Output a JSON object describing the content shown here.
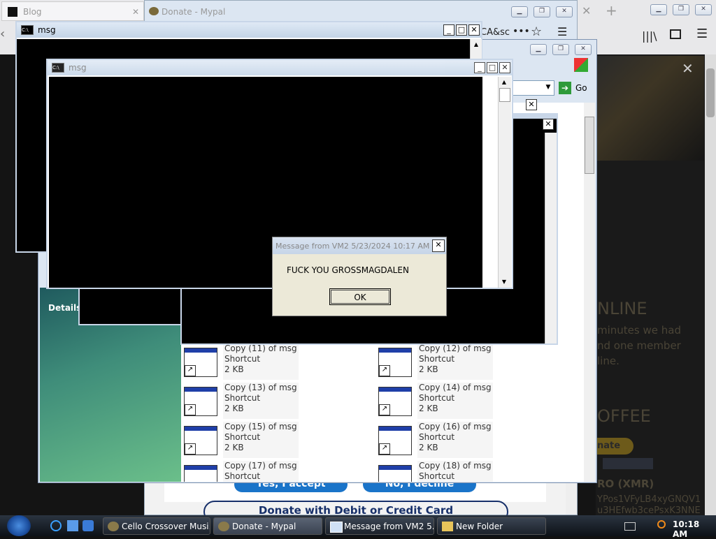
{
  "browser": {
    "tab_blog": "Blog",
    "tab_donate": "Donate - Mypal",
    "address_fragment": "CA&sc",
    "menu_dots": "•••"
  },
  "right_page": {
    "heading_online": "NLINE",
    "text_line1": "minutes we had",
    "text_line2": "nd one member",
    "text_line3": "line.",
    "heading_coffee": "OFFEE",
    "donate_btn": "nate",
    "xmr_label": "RO (XMR)",
    "xmr_addr1": "YPos1VFyLB4xyGNQV1",
    "xmr_addr2": "u3HEfwb3cePsxK3NNE"
  },
  "donate_page": {
    "yes_btn": "Yes, I accept",
    "no_btn": "No, I decline",
    "debit_btn": "Donate with Debit or Credit Card"
  },
  "cmd_window_back": {
    "title": "msg"
  },
  "cmd_window_front": {
    "title": "msg"
  },
  "explorer": {
    "go_label": "Go",
    "details_label": "Details",
    "files": [
      {
        "name": "Copy (11) of msg",
        "type": "Shortcut",
        "size": "2 KB"
      },
      {
        "name": "Copy (12) of msg",
        "type": "Shortcut",
        "size": "2 KB"
      },
      {
        "name": "Copy (13) of msg",
        "type": "Shortcut",
        "size": "2 KB"
      },
      {
        "name": "Copy (14) of msg",
        "type": "Shortcut",
        "size": "2 KB"
      },
      {
        "name": "Copy (15) of msg",
        "type": "Shortcut",
        "size": "2 KB"
      },
      {
        "name": "Copy (16) of msg",
        "type": "Shortcut",
        "size": "2 KB"
      },
      {
        "name": "Copy (17) of msg",
        "type": "Shortcut",
        "size": ""
      },
      {
        "name": "Copy (18) of msg",
        "type": "Shortcut",
        "size": ""
      }
    ]
  },
  "dialog": {
    "title": "Message from VM2 5/23/2024 10:17 AM",
    "message": "FUCK YOU GROSSMAGDALEN",
    "ok": "OK"
  },
  "taskbar": {
    "items": [
      {
        "label": "Cello Crossover Musi..."
      },
      {
        "label": "Donate - Mypal"
      },
      {
        "label": "Message from VM2 5..."
      },
      {
        "label": "New Folder"
      }
    ],
    "clock": "10:18 AM"
  },
  "colors": {
    "titlebar": "#c3d4e7",
    "taskbar": "#1a2029",
    "folder_sidebar": "#5fae8a",
    "button_blue": "#1a74c9"
  }
}
